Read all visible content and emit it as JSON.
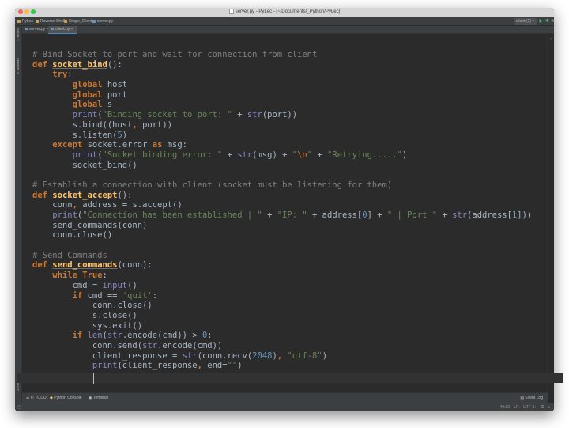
{
  "window": {
    "title": "server.py - PyLec - [~/Documents/_Python/PyLec]"
  },
  "navbar": {
    "breadcrumbs": [
      "PyLec",
      "Reverse Shell",
      "Single_Client",
      "server.py"
    ],
    "run_config": "client (1)",
    "icons": [
      "run-icon",
      "debug-icon",
      "stop-icon"
    ]
  },
  "tabs": [
    {
      "label": "server.py",
      "active": false
    },
    {
      "label": "client.py",
      "active": true
    }
  ],
  "sidebar": {
    "project_label": "1: Project",
    "structure_label": "Z: Structure",
    "favorites_label": "2: Favorites"
  },
  "toolwindows": {
    "todo": "6: TODO",
    "console": "Python Console",
    "terminal": "Terminal",
    "event_log": "Event Log"
  },
  "status": {
    "position": "49:13",
    "line_sep": "LF÷",
    "encoding": "UTF-8÷"
  },
  "colors": {
    "keyword": "#cc7832",
    "function": "#ffc66d",
    "comment": "#808080",
    "string": "#6a8759",
    "builtin": "#8888c6",
    "number": "#6897bb",
    "text": "#a9b7c6",
    "background": "#2b2b2b"
  },
  "code": {
    "lines": [
      [
        [
          "cm",
          "# Bind Socket to port and wait for connection from client"
        ]
      ],
      [
        [
          "kw",
          "def "
        ],
        [
          "fn",
          "socket_bind"
        ],
        [
          "",
          "():"
        ]
      ],
      [
        [
          "",
          "    "
        ],
        [
          "kw",
          "try"
        ],
        [
          "",
          ":"
        ]
      ],
      [
        [
          "",
          "        "
        ],
        [
          "kw",
          "global "
        ],
        [
          "",
          "host"
        ]
      ],
      [
        [
          "",
          "        "
        ],
        [
          "kw",
          "global "
        ],
        [
          "",
          "port"
        ]
      ],
      [
        [
          "",
          "        "
        ],
        [
          "kw",
          "global "
        ],
        [
          "",
          "s"
        ]
      ],
      [
        [
          "",
          "        "
        ],
        [
          "bi",
          "print"
        ],
        [
          "",
          "("
        ],
        [
          "st",
          "\"Binding socket to port: \""
        ],
        [
          "",
          " + "
        ],
        [
          "bi",
          "str"
        ],
        [
          "",
          "(port))"
        ]
      ],
      [
        [
          "",
          "        s.bind((host"
        ],
        [
          "kw",
          ", "
        ],
        [
          "",
          "port))"
        ]
      ],
      [
        [
          "",
          "        s.listen("
        ],
        [
          "nm",
          "5"
        ],
        [
          "",
          ")"
        ]
      ],
      [
        [
          "",
          "    "
        ],
        [
          "kw",
          "except "
        ],
        [
          "",
          "socket.error "
        ],
        [
          "kw",
          "as "
        ],
        [
          "",
          "msg:"
        ]
      ],
      [
        [
          "",
          "        "
        ],
        [
          "bi",
          "print"
        ],
        [
          "",
          "("
        ],
        [
          "st",
          "\"Socket binding error: \""
        ],
        [
          "",
          " + "
        ],
        [
          "bi",
          "str"
        ],
        [
          "",
          "(msg) + "
        ],
        [
          "st",
          "\""
        ],
        [
          "esc",
          "\\n"
        ],
        [
          "st",
          "\""
        ],
        [
          "",
          " + "
        ],
        [
          "st",
          "\"Retrying.....\""
        ],
        [
          "",
          ")"
        ]
      ],
      [
        [
          "",
          "        socket_bind()"
        ]
      ],
      [
        [
          "",
          ""
        ]
      ],
      [
        [
          "cm",
          "# Establish a connection with client (socket must be listening for them)"
        ]
      ],
      [
        [
          "kw",
          "def "
        ],
        [
          "fn",
          "socket_accept"
        ],
        [
          "",
          "():"
        ]
      ],
      [
        [
          "",
          "    conn"
        ],
        [
          "kw",
          ", "
        ],
        [
          "",
          "address = s.accept()"
        ]
      ],
      [
        [
          "",
          "    "
        ],
        [
          "bi",
          "print"
        ],
        [
          "",
          "("
        ],
        [
          "st",
          "\"Connection has been established | \""
        ],
        [
          "",
          " + "
        ],
        [
          "st",
          "\"IP: \""
        ],
        [
          "",
          " + address["
        ],
        [
          "nm",
          "0"
        ],
        [
          "",
          "] + "
        ],
        [
          "st",
          "\" | Port \""
        ],
        [
          "",
          " + "
        ],
        [
          "bi",
          "str"
        ],
        [
          "",
          "(address["
        ],
        [
          "nm",
          "1"
        ],
        [
          "",
          "]))"
        ]
      ],
      [
        [
          "",
          "    send_commands(conn)"
        ]
      ],
      [
        [
          "",
          "    conn.close()"
        ]
      ],
      [
        [
          "",
          ""
        ]
      ],
      [
        [
          "cm",
          "# Send Commands"
        ]
      ],
      [
        [
          "kw",
          "def "
        ],
        [
          "fn",
          "send_commands"
        ],
        [
          "",
          "(conn):"
        ]
      ],
      [
        [
          "",
          "    "
        ],
        [
          "kw",
          "while True"
        ],
        [
          "",
          ":"
        ]
      ],
      [
        [
          "",
          "        cmd = "
        ],
        [
          "bi",
          "input"
        ],
        [
          "",
          "()"
        ]
      ],
      [
        [
          "",
          "        "
        ],
        [
          "kw",
          "if "
        ],
        [
          "",
          "cmd == "
        ],
        [
          "st",
          "'quit'"
        ],
        [
          "",
          ":"
        ]
      ],
      [
        [
          "",
          "            conn.close()"
        ]
      ],
      [
        [
          "",
          "            s.close()"
        ]
      ],
      [
        [
          "",
          "            sys.exit()"
        ]
      ],
      [
        [
          "",
          "        "
        ],
        [
          "kw",
          "if "
        ],
        [
          "bi",
          "len"
        ],
        [
          "",
          "("
        ],
        [
          "bi",
          "str"
        ],
        [
          "",
          ".encode(cmd)) > "
        ],
        [
          "nm",
          "0"
        ],
        [
          "",
          ":"
        ]
      ],
      [
        [
          "",
          "            conn.send("
        ],
        [
          "bi",
          "str"
        ],
        [
          "",
          ".encode(cmd))"
        ]
      ],
      [
        [
          "",
          "            client_response = "
        ],
        [
          "bi",
          "str"
        ],
        [
          "",
          "(conn.recv("
        ],
        [
          "nm",
          "2048"
        ],
        [
          "",
          ")"
        ],
        [
          "kw",
          ", "
        ],
        [
          "st",
          "\"utf-8\""
        ],
        [
          "",
          ")"
        ]
      ],
      [
        [
          "",
          "            "
        ],
        [
          "bi",
          "print"
        ],
        [
          "",
          "(client_response"
        ],
        [
          "kw",
          ", "
        ],
        [
          "",
          "end="
        ],
        [
          "st",
          "\"\""
        ],
        [
          "",
          ")"
        ]
      ]
    ]
  }
}
